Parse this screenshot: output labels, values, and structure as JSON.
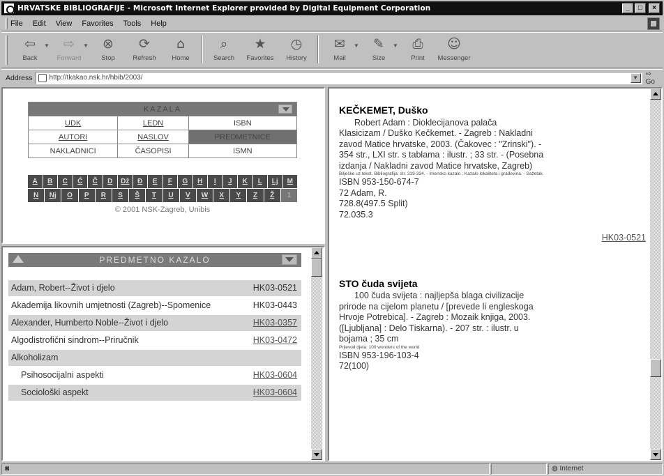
{
  "window": {
    "title": "HRVATSKE BIBLIOGRAFIJE - Microsoft Internet Explorer provided by Digital Equipment Corporation",
    "buttons": [
      "_",
      "□",
      "×"
    ]
  },
  "menu": [
    "File",
    "Edit",
    "View",
    "Favorites",
    "Tools",
    "Help"
  ],
  "toolbar": [
    {
      "icon": "⇦",
      "label": "Back",
      "name": "back",
      "disabled": false,
      "drop": true
    },
    {
      "icon": "⇨",
      "label": "Forward",
      "name": "forward",
      "disabled": true,
      "drop": true
    },
    {
      "icon": "⊗",
      "label": "Stop",
      "name": "stop",
      "disabled": false
    },
    {
      "icon": "⟳",
      "label": "Refresh",
      "name": "refresh",
      "disabled": false
    },
    {
      "icon": "⌂",
      "label": "Home",
      "name": "home",
      "disabled": false,
      "sepAfter": true
    },
    {
      "icon": "⌕",
      "label": "Search",
      "name": "search",
      "disabled": false
    },
    {
      "icon": "★",
      "label": "Favorites",
      "name": "favorites",
      "disabled": false
    },
    {
      "icon": "◷",
      "label": "History",
      "name": "history",
      "disabled": false,
      "sepAfter": true
    },
    {
      "icon": "✉",
      "label": "Mail",
      "name": "mail",
      "disabled": false,
      "drop": true
    },
    {
      "icon": "✎",
      "label": "Size",
      "name": "size",
      "disabled": false,
      "drop": true
    },
    {
      "icon": "⎙",
      "label": "Print",
      "name": "print",
      "disabled": false
    },
    {
      "icon": "☺",
      "label": "Messenger",
      "name": "messenger",
      "disabled": false
    }
  ],
  "address": {
    "label": "Address",
    "value": "http://tkakao.nsk.hr/hbib/2003/",
    "go": "Go"
  },
  "nav": {
    "header": "KAZALA",
    "rows": [
      [
        {
          "t": "UDK",
          "s": "link"
        },
        {
          "t": "LEDN",
          "s": "link"
        },
        {
          "t": "ISBN",
          "s": "plain"
        }
      ],
      [
        {
          "t": "AUTORI",
          "s": "link"
        },
        {
          "t": "NASLOV",
          "s": "link"
        },
        {
          "t": "PREDMETNICE",
          "s": "active"
        }
      ],
      [
        {
          "t": "NAKLADNICI",
          "s": "plain"
        },
        {
          "t": "ČASOPISI",
          "s": "plain"
        },
        {
          "t": "ISMN",
          "s": "plain"
        }
      ]
    ],
    "letters": [
      [
        "A",
        "B",
        "C",
        "Ć",
        "Č",
        "D",
        "Dž",
        "Đ",
        "E",
        "F",
        "G",
        "H",
        "I",
        "J",
        "K",
        "L",
        "Lj",
        "M"
      ],
      [
        "N",
        "Nj",
        "O",
        "P",
        "R",
        "S",
        "Š",
        "T",
        "U",
        "V",
        "W",
        "X",
        "Y",
        "Z",
        "Ž",
        "1"
      ]
    ],
    "copyright": "© 2001 NSK-Zagreb, Unibis"
  },
  "index": {
    "header": "PREDMETNO KAZALO",
    "rows": [
      {
        "term": "Adam, Robert--Život i djelo",
        "sig": "HK03-0521",
        "link": false,
        "shade": true,
        "indent": false
      },
      {
        "term": "Akademija likovnih umjetnosti (Zagreb)--Spomenice",
        "sig": "HK03-0443",
        "link": false,
        "shade": false,
        "indent": false,
        "wrap": true
      },
      {
        "term": "Alexander, Humberto Noble--Život i djelo",
        "sig": "HK03-0357",
        "link": true,
        "shade": true,
        "indent": false,
        "wrap": true
      },
      {
        "term": "Algodistrofični sindrom--Priručnik",
        "sig": "HK03-0472",
        "link": true,
        "shade": false,
        "indent": false
      },
      {
        "term": "Alkoholizam",
        "sig": "",
        "link": false,
        "shade": true,
        "indent": false
      },
      {
        "term": "Psihosocijalni aspekti",
        "sig": "HK03-0604",
        "link": true,
        "shade": false,
        "indent": true
      },
      {
        "term": "Sociološki aspekt",
        "sig": "HK03-0604",
        "link": true,
        "shade": true,
        "indent": true
      }
    ]
  },
  "main": {
    "entries": [
      {
        "title": "KEČKEMET, Duško",
        "body": "Robert Adam : Dioklecijanova palača",
        "lines": [
          "Klasicizam / Duško Kečkemet. - Zagreb : Nakladni",
          "zavod Matice hrvatske, 2003. (Čakovec : \"Zrinski\"). -",
          "354 str., LXI str. s tablama : ilustr. ; 33 str. - (Posebna",
          "izdanja / Nakladni zavod Matice hrvatske, Zagreb)"
        ],
        "fine": "Bilješke uz tekst. Bibliografija: str. 319-334. - Imensko kazalo ; Kazalo lokaliteta i građevina. - Sažetak.",
        "after": [
          "ISBN 953-150-674-7",
          "72 Adam, R.",
          "728.8(497.5 Split)",
          "72.035.3"
        ],
        "sig": "HK03-0521"
      },
      {
        "title": "STO čuda svijeta",
        "body": "100 čuda svijeta : najljepša blaga civilizacije",
        "lines": [
          "prirode na cijelom planetu / [prevede li engleskoga",
          "Hrvoje Potrebica]. - Zagreb : Mozaik knjiga, 2003.",
          "([Ljubljana] : Delo Tiskarna). - 207 str. : ilustr. u",
          "bojama ; 35 cm"
        ],
        "fine": "Prijevod djela: 100 wonders of the world",
        "after": [
          "ISBN 953-196-103-4",
          "72(100)"
        ],
        "sig": ""
      }
    ]
  },
  "status": {
    "left": "",
    "zone": "Internet"
  }
}
